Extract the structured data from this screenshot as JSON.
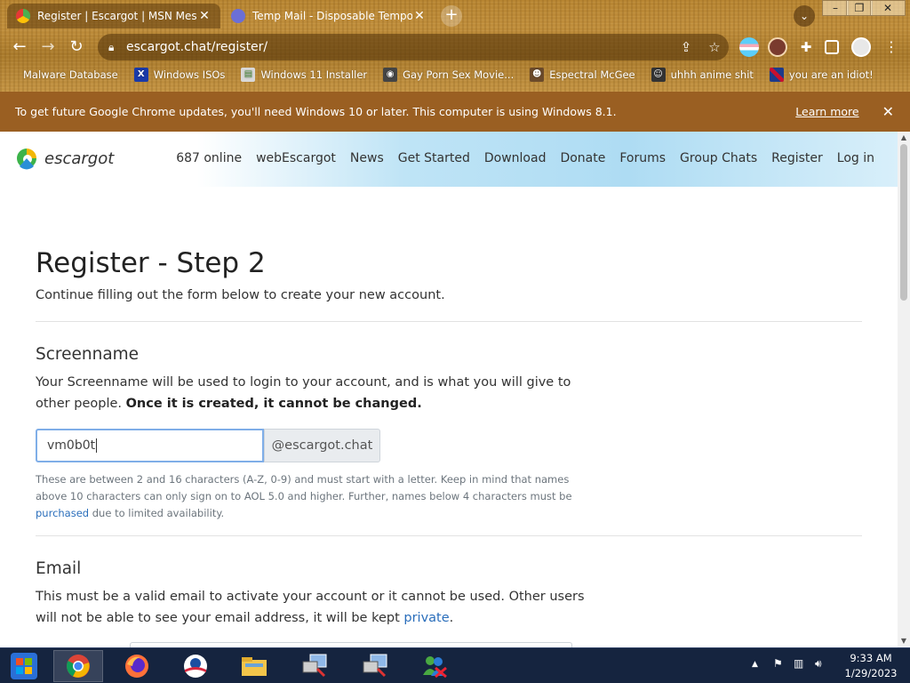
{
  "browser": {
    "tabs": [
      {
        "title": "Register | Escargot | MSN Messe",
        "active": true
      },
      {
        "title": "Temp Mail - Disposable Temporar",
        "active": false
      }
    ],
    "url": "escargot.chat/register/",
    "bookmarks": [
      "Malware Database",
      "Windows ISOs",
      "Windows 11 Installer",
      "Gay Porn Sex Movie...",
      "Espectral McGee",
      "uhhh anime shit",
      "you are an idiot!"
    ]
  },
  "infobar": {
    "message": "To get future Google Chrome updates, you'll need Windows 10 or later. This computer is using Windows 8.1.",
    "link": "Learn more"
  },
  "site": {
    "logo_text": "escargot",
    "nav": [
      "687 online",
      "webEscargot",
      "News",
      "Get Started",
      "Download",
      "Donate",
      "Forums",
      "Group Chats",
      "Register",
      "Log in"
    ]
  },
  "page": {
    "title": "Register - Step 2",
    "lead": "Continue filling out the form below to create your new account.",
    "screenname": {
      "heading": "Screenname",
      "desc_plain": "Your Screenname will be used to login to your account, and is what you will give to other people.",
      "desc_bold": "Once it is created, it cannot be changed.",
      "value": "vm0b0t",
      "suffix": "@escargot.chat",
      "help_before": "These are between 2 and 16 characters (A-Z, 0-9) and must start with a letter. Keep in mind that names above 10 characters can only sign on to AOL 5.0 and higher. Further, names below 4 characters must be",
      "help_link": "purchased",
      "help_after": "due to limited availability."
    },
    "email": {
      "heading": "Email",
      "desc_before": "This must be a valid email to activate your account or it cannot be used. Other users will not be able to see your email address, it will be kept",
      "desc_link": "private",
      "desc_after": "."
    }
  },
  "taskbar": {
    "time": "9:33 AM",
    "date": "1/29/2023"
  }
}
